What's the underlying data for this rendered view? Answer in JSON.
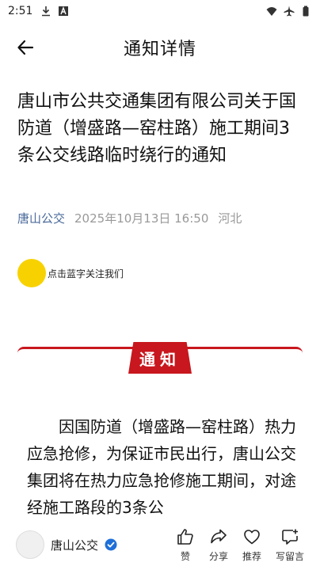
{
  "status_bar": {
    "time": "2:51",
    "left_icons": [
      "download-icon",
      "app-icon"
    ],
    "right_icons": [
      "wifi-icon",
      "airplane-icon",
      "battery-icon"
    ]
  },
  "header": {
    "title": "通知详情"
  },
  "article": {
    "title": "唐山市公共交通集团有限公司关于国防道（增盛路—窑柱路）施工期间3条公交线路临时绕行的通知",
    "account": "唐山公交",
    "date": "2025年10月13日 16:50",
    "region": "河北",
    "follow_prompt": "点击蓝字关注我们",
    "banner_label": "通知",
    "body": "因国防道（增盛路—窑柱路）热力应急抢修，为保证市民出行，唐山公交集团将在热力应急抢修施工期间，对途经施工路段的3条公"
  },
  "bottom_bar": {
    "account_name": "唐山公交",
    "actions": [
      {
        "label": "赞",
        "icon": "thumbs-up-icon"
      },
      {
        "label": "分享",
        "icon": "share-icon"
      },
      {
        "label": "推荐",
        "icon": "heart-icon"
      },
      {
        "label": "写留言",
        "icon": "comment-icon"
      }
    ]
  },
  "colors": {
    "banner_red": "#c8171e",
    "follow_yellow": "#f7d200",
    "account_blue": "#4a6a9a",
    "verified_blue": "#1e6fd9"
  }
}
